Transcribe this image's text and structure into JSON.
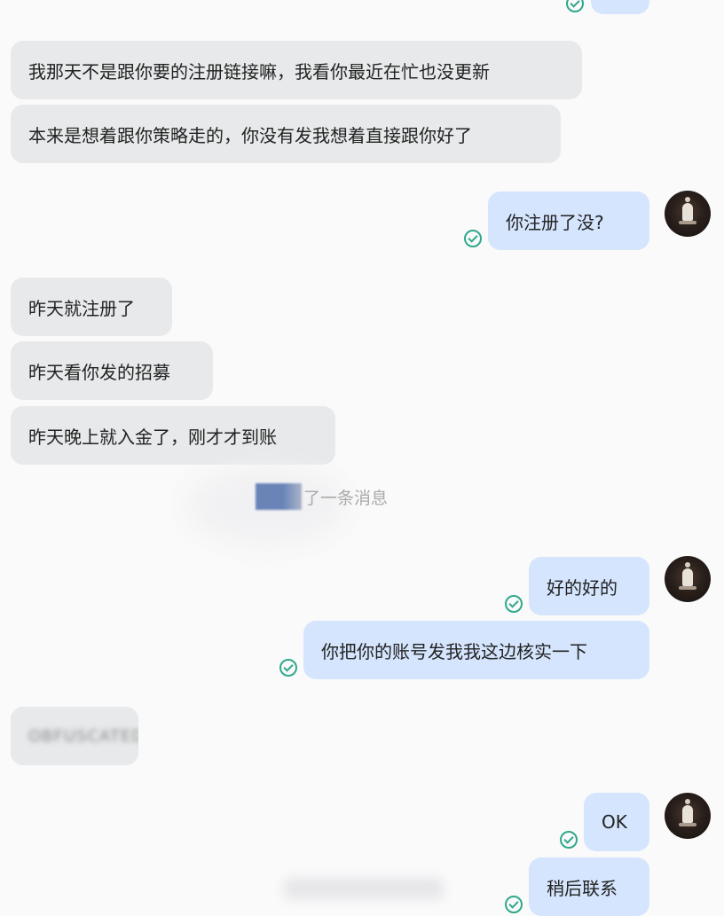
{
  "messages": [
    {
      "side": "in",
      "text": "我那天不是跟你要的注册链接嘛，我看你最近在忙也没更新"
    },
    {
      "side": "in",
      "text": "本来是想着跟你策略走的，你没有发我想着直接跟你好了"
    },
    {
      "side": "out",
      "text": "你注册了没?"
    },
    {
      "side": "in",
      "text": "昨天就注册了"
    },
    {
      "side": "in",
      "text": "昨天看你发的招募"
    },
    {
      "side": "in",
      "text": "昨天晚上就入金了，刚才才到账"
    },
    {
      "side": "out",
      "text": "好的好的"
    },
    {
      "side": "out",
      "text": "你把你的账号发我我这边核实一下"
    },
    {
      "side": "in",
      "text": "OBFUSCATED"
    },
    {
      "side": "out",
      "text": "OK"
    },
    {
      "side": "out",
      "text": "稍后联系"
    }
  ],
  "system_notice": {
    "text": "了一条消息"
  },
  "colors": {
    "incoming": "#e7e9ea",
    "outgoing": "#d4e5fd",
    "check": "#2fa88d",
    "background": "#fafafa"
  },
  "icons": {
    "read_receipt": "check-circle-icon",
    "avatar": "user-avatar"
  }
}
